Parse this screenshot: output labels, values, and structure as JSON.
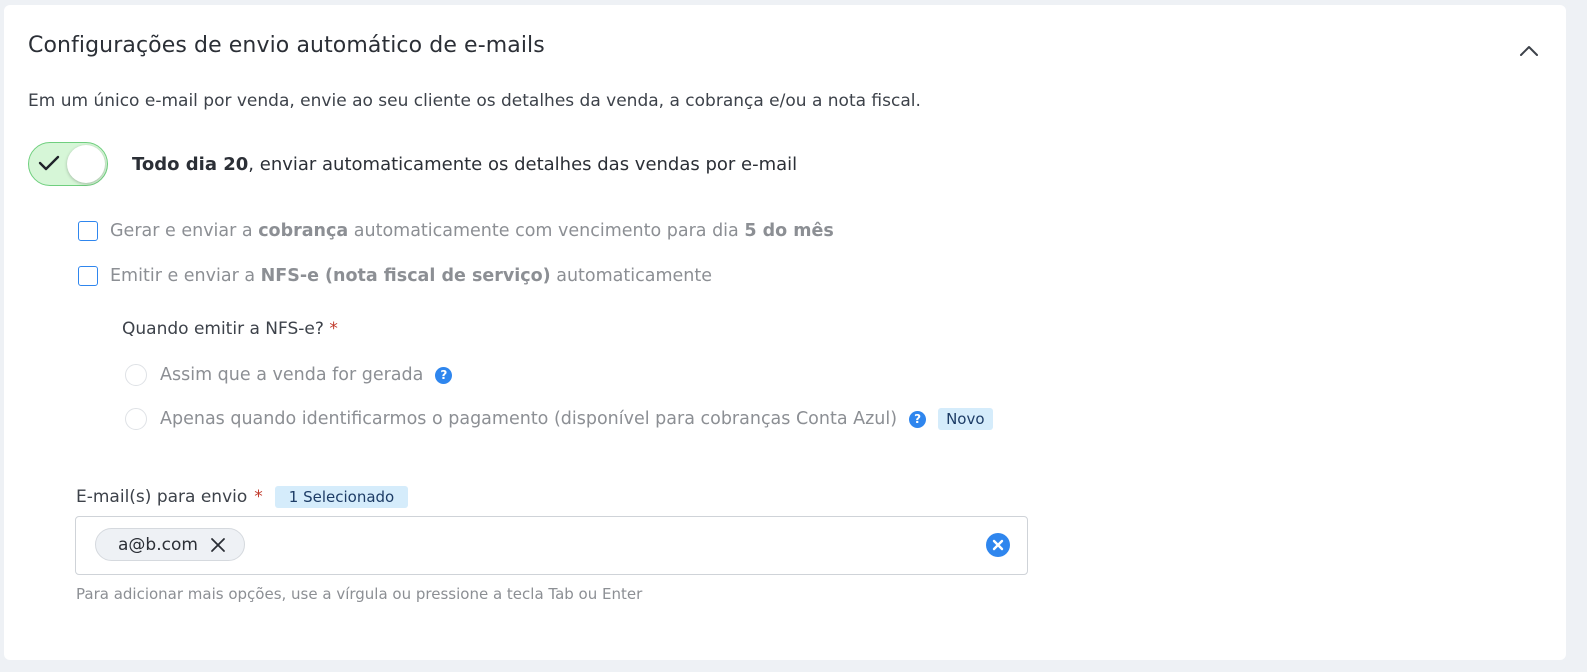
{
  "section": {
    "title": "Configurações de envio automático de e-mails",
    "description": "Em um único e-mail por venda, envie ao seu cliente os detalhes da venda, a cobrança e/ou a nota fiscal."
  },
  "toggle": {
    "checked": true,
    "label_bold": "Todo dia 20",
    "label_rest": ", enviar automaticamente os detalhes das vendas por e-mail"
  },
  "options": {
    "charge": {
      "checked": false,
      "text_1": "Gerar e enviar a ",
      "bold_1": "cobrança",
      "text_2": " automaticamente com vencimento para dia ",
      "bold_2": "5 do mês"
    },
    "nfse": {
      "checked": false,
      "text_1": "Emitir e enviar a ",
      "bold_1": "NFS-e (nota fiscal de serviço)",
      "text_2": " automaticamente"
    }
  },
  "nfse_when": {
    "label": "Quando emitir a NFS-e?",
    "required_mark": "*",
    "radios": [
      {
        "label": "Assim que a venda for gerada",
        "selected": false,
        "help": "?"
      },
      {
        "label": "Apenas quando identificarmos o pagamento (disponível para cobranças Conta Azul)",
        "selected": false,
        "help": "?",
        "badge": "Novo"
      }
    ]
  },
  "emails": {
    "label": "E-mail(s) para envio",
    "required_mark": "*",
    "selected_badge": "1 Selecionado",
    "chips": [
      "a@b.com"
    ],
    "hint": "Para adicionar mais opções, use a vírgula ou pressione a tecla Tab ou Enter"
  },
  "colors": {
    "accent": "#2f86ee",
    "toggle_on_bg": "#d6f6d7",
    "toggle_on_border": "#6fcf7e",
    "required": "#c0392b",
    "badge_bg": "#d5ecfb"
  }
}
